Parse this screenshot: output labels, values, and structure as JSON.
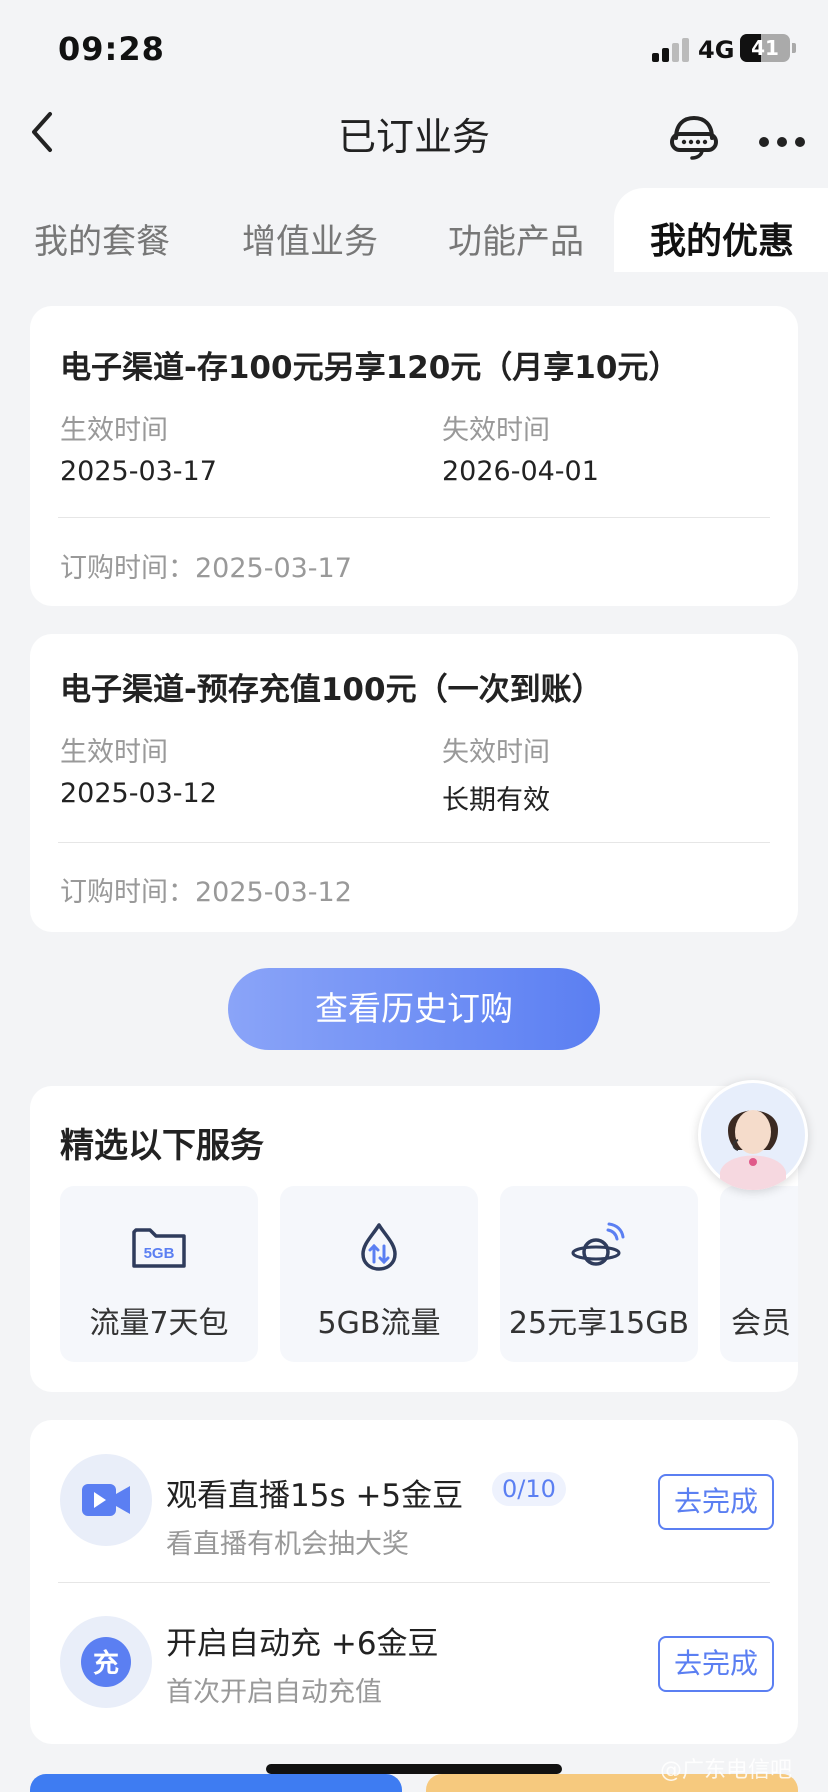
{
  "status_bar": {
    "time": "09:28",
    "network": "4G",
    "battery": "41",
    "battery_level": 0.41
  },
  "nav": {
    "title": "已订业务"
  },
  "tabs": [
    {
      "label": "我的套餐",
      "active": false
    },
    {
      "label": "增值业务",
      "active": false
    },
    {
      "label": "功能产品",
      "active": false
    },
    {
      "label": "我的优惠",
      "active": true
    }
  ],
  "subscriptions": [
    {
      "title": "电子渠道-存100元另享120元（月享10元）",
      "effective_label": "生效时间",
      "effective_value": "2025-03-17",
      "expire_label": "失效时间",
      "expire_value": "2026-04-01",
      "order_label": "订购时间：",
      "order_value": "2025-03-17"
    },
    {
      "title": "电子渠道-预存充值100元（一次到账）",
      "effective_label": "生效时间",
      "effective_value": "2025-03-12",
      "expire_label": "失效时间",
      "expire_value": "长期有效",
      "order_label": "订购时间：",
      "order_value": "2025-03-12"
    }
  ],
  "history_button": "查看历史订购",
  "services": {
    "title": "精选以下服务",
    "items": [
      {
        "label": "流量7天包",
        "icon": "5gb-folder-icon",
        "icon_text": "5GB"
      },
      {
        "label": "5GB流量",
        "icon": "data-drop-icon"
      },
      {
        "label": "25元享15GB",
        "icon": "planet-signal-icon"
      },
      {
        "label": "会员",
        "icon": "member-icon"
      }
    ]
  },
  "tasks": [
    {
      "title": "观看直播15s +5金豆",
      "badge": "0/10",
      "subtitle": "看直播有机会抽大奖",
      "button": "去完成",
      "icon": "video-camera-icon"
    },
    {
      "title": "开启自动充 +6金豆",
      "subtitle": "首次开启自动充值",
      "button": "去完成",
      "icon": "recharge-icon",
      "icon_text": "充"
    }
  ],
  "watermark": "@广东电信吧",
  "colors": {
    "accent": "#5b7ff2",
    "page_bg": "#f3f4f6",
    "card_bg": "#ffffff"
  }
}
